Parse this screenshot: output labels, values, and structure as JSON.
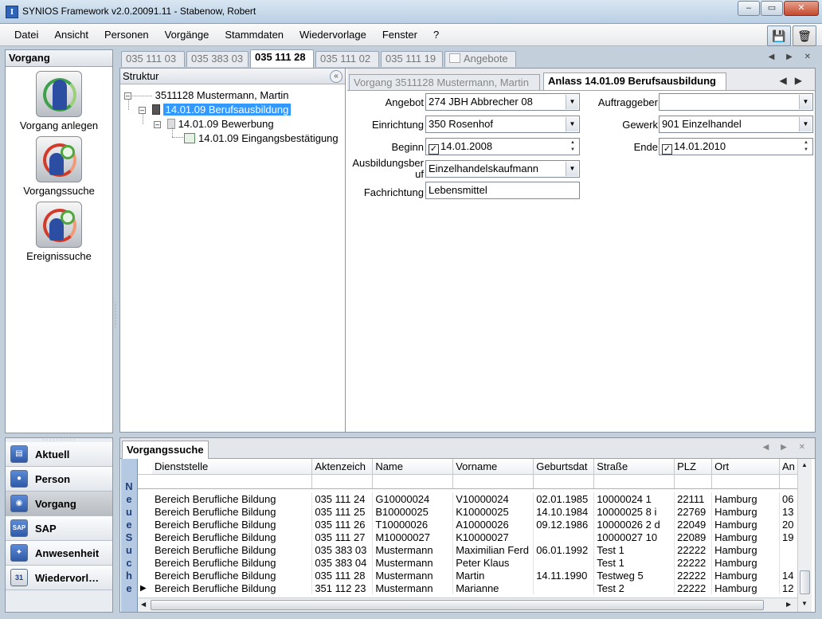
{
  "window": {
    "title": "SYNIOS Framework v2.0.20091.11 - Stabenow, Robert",
    "app_icon": "I"
  },
  "menu": [
    "Datei",
    "Ansicht",
    "Personen",
    "Vorgänge",
    "Stammdaten",
    "Wiedervorlage",
    "Fenster",
    "?"
  ],
  "left_panel": {
    "title": "Vorgang",
    "actions": [
      {
        "label": "Vorgang anlegen",
        "icon": "person-add-icon"
      },
      {
        "label": "Vorgangssuche",
        "icon": "search-icon"
      },
      {
        "label": "Ereignissuche",
        "icon": "event-search-icon"
      }
    ]
  },
  "nav": [
    {
      "label": "Aktuell",
      "icon": "current-icon"
    },
    {
      "label": "Person",
      "icon": "person-icon"
    },
    {
      "label": "Vorgang",
      "icon": "case-icon",
      "active": true
    },
    {
      "label": "SAP",
      "icon": "sap-icon",
      "icon_text": "SAP"
    },
    {
      "label": "Anwesenheit",
      "icon": "attendance-icon"
    },
    {
      "label": "Wiedervorl…",
      "icon": "resubmission-icon",
      "icon_text": "31"
    }
  ],
  "doc_tabs": [
    {
      "label": "035 111 03"
    },
    {
      "label": "035 383 03"
    },
    {
      "label": "035 111 28",
      "active": true
    },
    {
      "label": "035 111 02"
    },
    {
      "label": "035 111 19"
    },
    {
      "label": "Angebote"
    }
  ],
  "structure": {
    "title": "Struktur",
    "nodes": [
      {
        "label": "3511128 Mustermann, Martin"
      },
      {
        "label": "14.01.09 Berufsausbildung",
        "selected": true
      },
      {
        "label": "14.01.09 Bewerbung"
      },
      {
        "label": "14.01.09 Eingangsbestätigung"
      }
    ]
  },
  "sub_tabs": [
    {
      "label": "Vorgang 3511128 Mustermann, Martin"
    },
    {
      "label": "Anlass 14.01.09 Berufsausbildung",
      "active": true
    }
  ],
  "form": {
    "angebot": {
      "label": "Angebot",
      "value": "274 JBH Abbrecher 08"
    },
    "einrichtung": {
      "label": "Einrichtung",
      "value": "350 Rosenhof"
    },
    "beginn": {
      "label": "Beginn",
      "value": "14.01.2008",
      "checked": true
    },
    "ausbildungsberuf": {
      "label_1": "Ausbildungsber",
      "label_2": "uf",
      "value": "Einzelhandelskaufmann"
    },
    "fachrichtung": {
      "label": "Fachrichtung",
      "value": "Lebensmittel"
    },
    "auftraggeber": {
      "label": "Auftraggeber",
      "value": ""
    },
    "gewerk": {
      "label": "Gewerk",
      "value": "901 Einzelhandel"
    },
    "ende": {
      "label": "Ende",
      "value": "14.01.2010",
      "checked": true
    }
  },
  "search_panel": {
    "tab": "Vorgangssuche",
    "new_search_letters": [
      "N",
      "e",
      "u",
      "e",
      "S",
      "u",
      "c",
      "h",
      "e"
    ],
    "columns": [
      "Dienststelle",
      "Aktenzeich",
      "Name",
      "Vorname",
      "Geburtsdat",
      "Straße",
      "PLZ",
      "Ort",
      "An"
    ],
    "rows": [
      [
        "Bereich Berufliche Bildung",
        "035 111 24",
        "G10000024",
        "V10000024",
        "02.01.1985",
        "10000024 1",
        "22111",
        "Hamburg",
        "06"
      ],
      [
        "Bereich Berufliche Bildung",
        "035 111 25",
        "B10000025",
        "K10000025",
        "14.10.1984",
        "10000025 8 i",
        "22769",
        "Hamburg",
        "13"
      ],
      [
        "Bereich Berufliche Bildung",
        "035 111 26",
        "T10000026",
        "A10000026",
        "09.12.1986",
        "10000026 2 d",
        "22049",
        "Hamburg",
        "20"
      ],
      [
        "Bereich Berufliche Bildung",
        "035 111 27",
        "M10000027",
        "K10000027",
        "",
        "10000027 10",
        "22089",
        "Hamburg",
        "19"
      ],
      [
        "Bereich Berufliche Bildung",
        "035 383 03",
        "Mustermann",
        "Maximilian Ferd",
        "06.01.1992",
        "Test 1",
        "22222",
        "Hamburg",
        ""
      ],
      [
        "Bereich Berufliche Bildung",
        "035 383 04",
        "Mustermann",
        "Peter Klaus",
        "",
        "Test 1",
        "22222",
        "Hamburg",
        ""
      ],
      [
        "Bereich Berufliche Bildung",
        "035 111 28",
        "Mustermann",
        "Martin",
        "14.11.1990",
        "Testweg 5",
        "22222",
        "Hamburg",
        "14"
      ],
      [
        "Bereich Berufliche Bildung",
        "351 112 23",
        "Mustermann",
        "Marianne",
        "",
        "Test 2",
        "22222",
        "Hamburg",
        "12"
      ]
    ],
    "current_row_marker": "▶"
  },
  "window_buttons": {
    "minimize": "–",
    "maximize": "▭",
    "close": "✕"
  },
  "accent_color": "#3399ff"
}
